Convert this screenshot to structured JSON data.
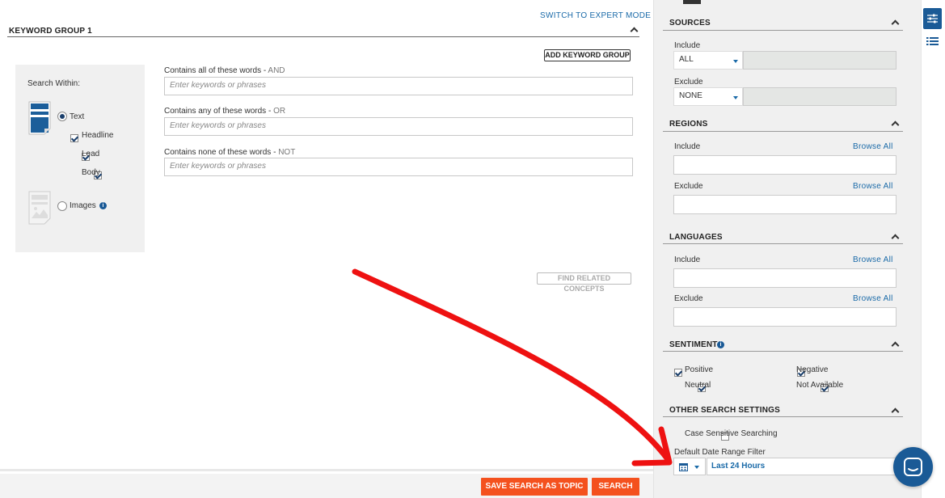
{
  "main": {
    "switch_expert": "SWITCH TO EXPERT MODE",
    "group_title": "KEYWORD GROUP 1",
    "add_group": "ADD KEYWORD GROUP",
    "search_within": "Search Within:",
    "text_option": "Text",
    "headline": "Headline",
    "lead": "Lead",
    "body": "Body",
    "images_option": "Images",
    "fields": [
      {
        "label": "Contains all of these words - ",
        "op": "AND",
        "placeholder": "Enter keywords or phrases"
      },
      {
        "label": "Contains any of these words - ",
        "op": "OR",
        "placeholder": "Enter keywords or phrases"
      },
      {
        "label": "Contains none of these words - ",
        "op": "NOT",
        "placeholder": "Enter keywords or phrases"
      }
    ],
    "find_related": "FIND RELATED CONCEPTS",
    "save_topic": "SAVE SEARCH AS TOPIC",
    "search": "SEARCH"
  },
  "side": {
    "sources": {
      "title": "SOURCES",
      "include": "Include",
      "include_val": "ALL",
      "exclude": "Exclude",
      "exclude_val": "NONE"
    },
    "regions": {
      "title": "REGIONS",
      "include": "Include",
      "exclude": "Exclude",
      "browse": "Browse All"
    },
    "languages": {
      "title": "LANGUAGES",
      "include": "Include",
      "exclude": "Exclude",
      "browse": "Browse All"
    },
    "sentiment": {
      "title": "SENTIMENT",
      "positive": "Positive",
      "negative": "Negative",
      "neutral": "Neutral",
      "not_available": "Not Available"
    },
    "other": {
      "title": "OTHER SEARCH SETTINGS",
      "case_sensitive": "Case Sensitive Searching",
      "date_label": "Default Date Range Filter",
      "date_val": "Last 24 Hours"
    }
  },
  "colors": {
    "accent": "#1a6aa8",
    "action": "#f4511e",
    "annotation_arrow": "#ee1111",
    "chat": "#1a5a96"
  }
}
